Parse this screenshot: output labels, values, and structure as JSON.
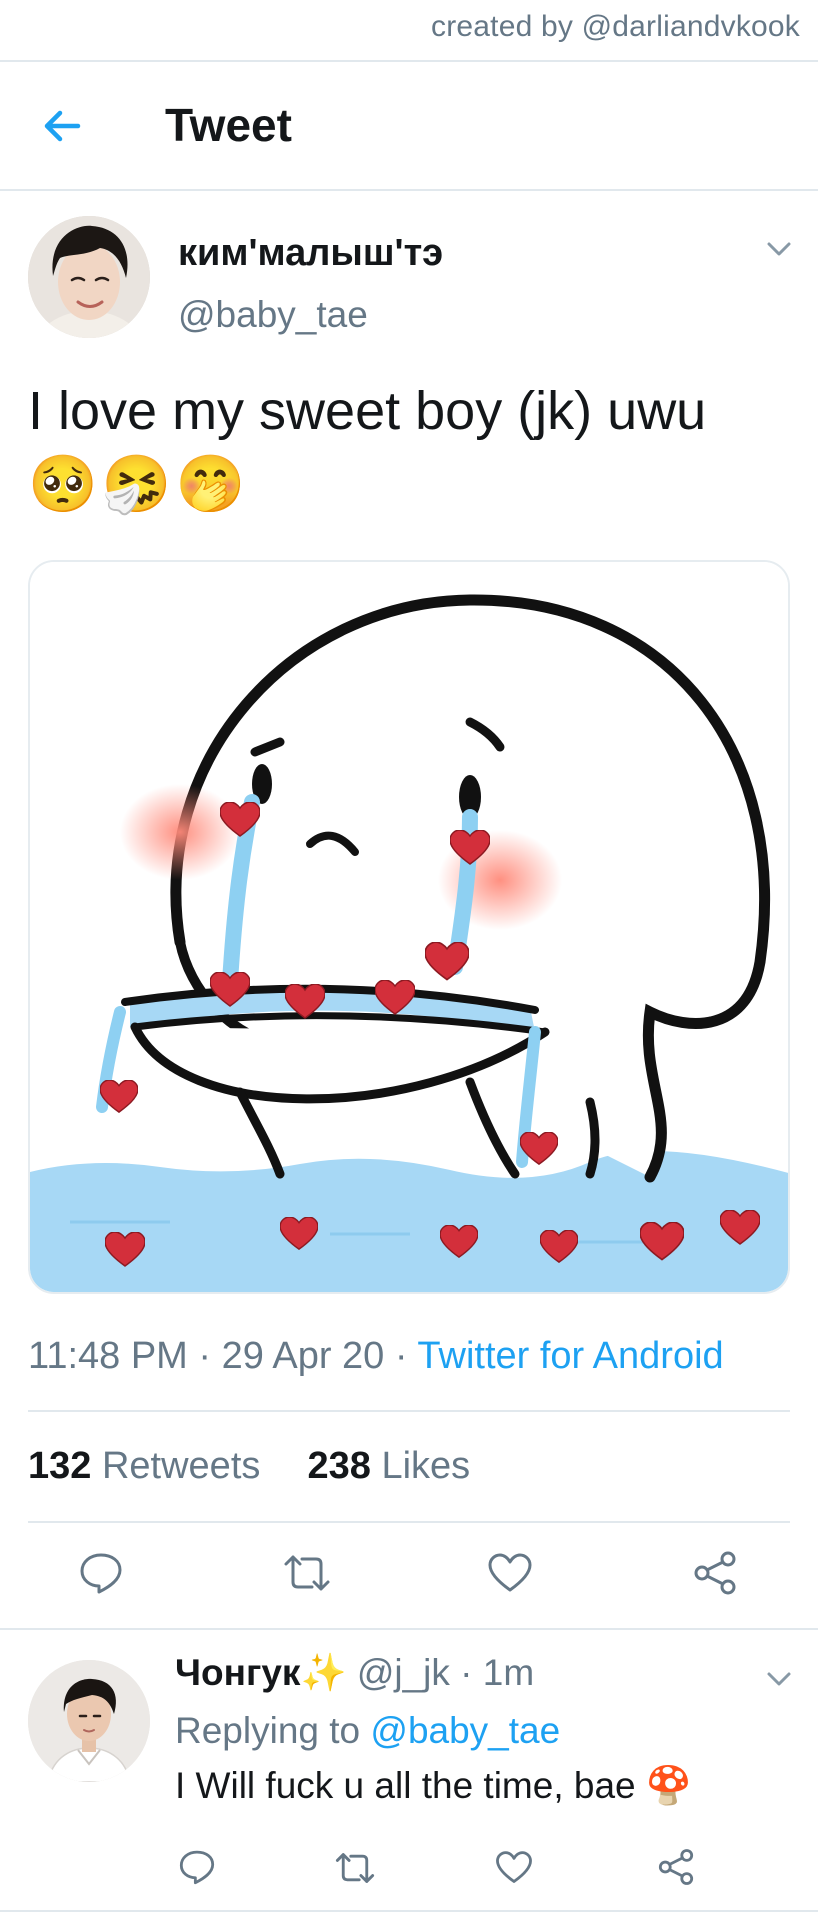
{
  "watermark": "created by @darliandvkook",
  "header": {
    "title": "Tweet"
  },
  "tweet": {
    "author_name": "ким'малыш'тэ",
    "author_handle": "@baby_tae",
    "text": "I love my sweet boy (jk) uwu",
    "emojis": [
      "🥺",
      "🤧",
      "🤭"
    ],
    "time": "11:48 PM",
    "date": "29 Apr 20",
    "source": "Twitter for Android",
    "retweets_count": "132",
    "retweets_label": "Retweets",
    "likes_count": "238",
    "likes_label": "Likes"
  },
  "reply": {
    "name": "Чонгук",
    "name_emoji": "✨",
    "handle": "@j_jk",
    "time": "1m",
    "replying_label": "Replying to",
    "replying_handle": "@baby_tae",
    "text": "I Will fuck u all the time, bae",
    "text_emoji": "🍄"
  },
  "icons": [
    "back-arrow-icon",
    "chevron-down-icon",
    "reply-icon",
    "retweet-icon",
    "like-icon",
    "share-icon"
  ],
  "colors": {
    "accent": "#1da1f2",
    "muted": "#657786",
    "text": "#14171a",
    "divider": "#e1e8ed",
    "heart": "#d32f3b",
    "water": "#a7d8f5"
  }
}
